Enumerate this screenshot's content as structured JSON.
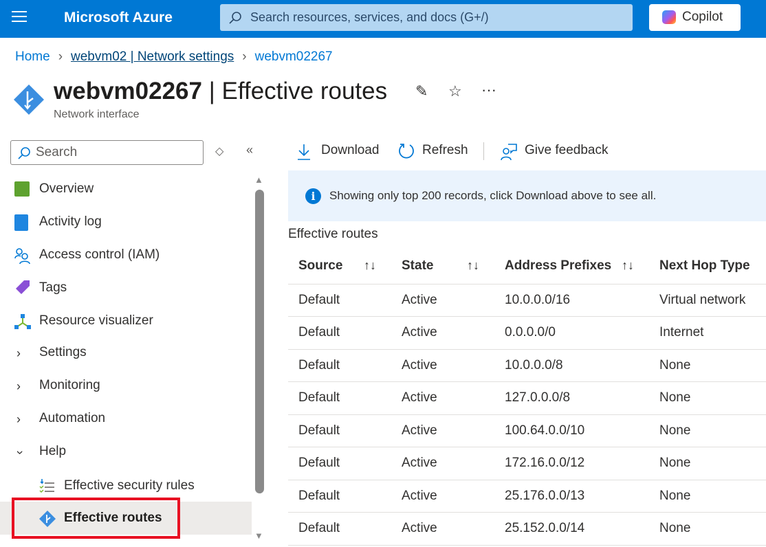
{
  "header": {
    "brand": "Microsoft Azure",
    "search_placeholder": "Search resources, services, and docs (G+/)",
    "copilot": "Copilot"
  },
  "breadcrumb": [
    "Home",
    "webvm02 | Network settings",
    "webvm02267"
  ],
  "page": {
    "resource": "webvm02267",
    "separator": " | ",
    "title": "Effective routes",
    "subtitle": "Network interface",
    "more": "···"
  },
  "sidebar": {
    "search_placeholder": "Search",
    "items": [
      {
        "label": "Overview"
      },
      {
        "label": "Activity log"
      },
      {
        "label": "Access control (IAM)"
      },
      {
        "label": "Tags"
      },
      {
        "label": "Resource visualizer"
      },
      {
        "label": "Settings"
      },
      {
        "label": "Monitoring"
      },
      {
        "label": "Automation"
      },
      {
        "label": "Help"
      },
      {
        "label": "Effective security rules"
      },
      {
        "label": "Effective routes"
      }
    ]
  },
  "toolbar": {
    "download": "Download",
    "refresh": "Refresh",
    "feedback": "Give feedback"
  },
  "info": "Showing only top 200 records, click Download above to see all.",
  "section_title": "Effective routes",
  "table": {
    "columns": [
      "Source",
      "State",
      "Address Prefixes",
      "Next Hop Type"
    ],
    "rows": [
      [
        "Default",
        "Active",
        "10.0.0.0/16",
        "Virtual network"
      ],
      [
        "Default",
        "Active",
        "0.0.0.0/0",
        "Internet"
      ],
      [
        "Default",
        "Active",
        "10.0.0.0/8",
        "None"
      ],
      [
        "Default",
        "Active",
        "127.0.0.0/8",
        "None"
      ],
      [
        "Default",
        "Active",
        "100.64.0.0/10",
        "None"
      ],
      [
        "Default",
        "Active",
        "172.16.0.0/12",
        "None"
      ],
      [
        "Default",
        "Active",
        "25.176.0.0/13",
        "None"
      ],
      [
        "Default",
        "Active",
        "25.152.0.0/14",
        "None"
      ]
    ]
  },
  "colors": {
    "accent": "#0078d4",
    "selected": "#edebe9",
    "highlight": "#e81123"
  }
}
